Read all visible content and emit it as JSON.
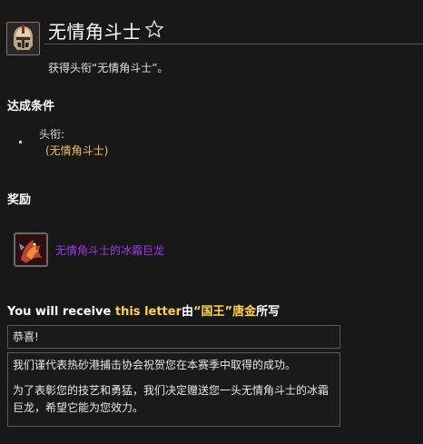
{
  "achievement": {
    "title": "无情角斗士",
    "description": "获得头衔“无情角斗士”。",
    "icon": "gladiator-helmet-icon",
    "favorite_icon": "star-outline-icon"
  },
  "criteria": {
    "heading": "达成条件",
    "items": [
      {
        "label": "头衔:",
        "value": "(无情角斗士)"
      }
    ]
  },
  "reward": {
    "heading": "奖励",
    "item_name": "无情角斗士的冰霜巨龙",
    "icon": "frost-wyrm-mount-icon",
    "item_color": "#a335ee"
  },
  "letter": {
    "heading_prefix": "You will receive ",
    "heading_link": "this letter",
    "heading_mid": "由",
    "heading_sender": "“国王”唐金",
    "heading_suffix": "所写",
    "greeting": "恭喜!",
    "paragraphs": [
      "我们谨代表热砂港捕击协会祝贺您在本赛季中取得的成功。",
      "为了表彰您的技艺和勇猛，我们决定赠送您一头无情角斗士的冰霜巨龙，希望它能为您效力。"
    ]
  },
  "colors": {
    "background": "#181818",
    "criteria_value": "#f0c060",
    "letter_highlight": "#ffd24a",
    "epic_purple": "#a335ee"
  }
}
